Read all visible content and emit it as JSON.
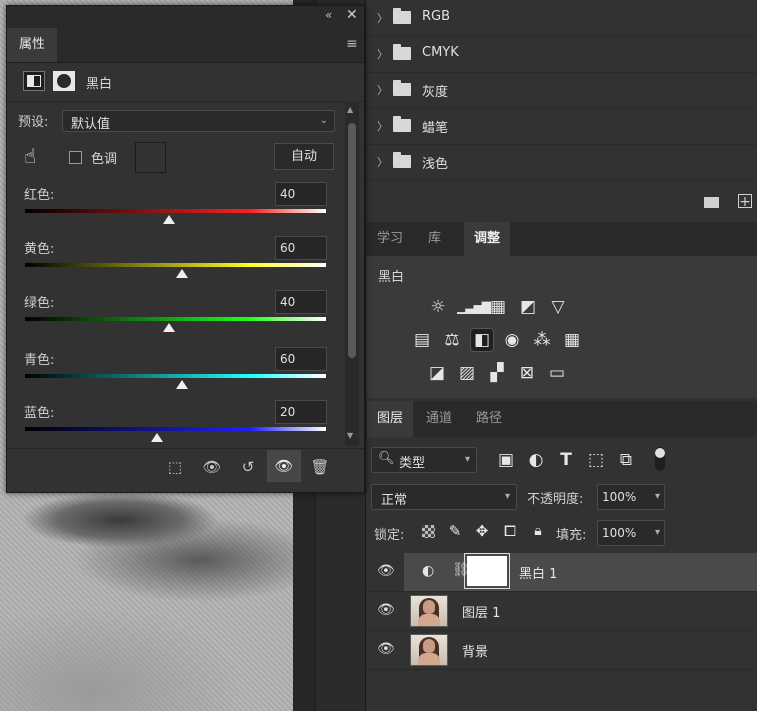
{
  "properties_panel": {
    "tab_label": "属性",
    "menu_icon": "hamburger-icon",
    "collapse_icon": "double-chevron-icon",
    "close_icon": "close-icon",
    "adjustment_name": "黑白",
    "preset_label": "预设:",
    "preset_value": "默认值",
    "tint_label": "色调",
    "auto_button": "自动",
    "sliders": [
      {
        "label": "红色:",
        "value": "40",
        "color": "#ff2020"
      },
      {
        "label": "黄色:",
        "value": "60",
        "color": "#ffff20"
      },
      {
        "label": "绿色:",
        "value": "40",
        "color": "#20ff20"
      },
      {
        "label": "青色:",
        "value": "60",
        "color": "#20ffff"
      },
      {
        "label": "蓝色:",
        "value": "20",
        "color": "#2020ff"
      }
    ]
  },
  "channels_panel": {
    "folders": [
      "RGB",
      "CMYK",
      "灰度",
      "蜡笔",
      "浅色"
    ]
  },
  "adjustments_panel": {
    "tabs": [
      "学习",
      "库",
      "调整"
    ],
    "active_tab": "调整",
    "current_label": "黑白"
  },
  "layers_panel": {
    "tabs": [
      "图层",
      "通道",
      "路径"
    ],
    "filter_kind": "类型",
    "blend_mode": "正常",
    "opacity_label": "不透明度:",
    "opacity_value": "100%",
    "lock_label": "锁定:",
    "fill_label": "填充:",
    "fill_value": "100%",
    "layers": [
      {
        "name": "黑白 1",
        "type": "adjustment",
        "selected": true
      },
      {
        "name": "图层 1",
        "type": "pixel",
        "selected": false
      },
      {
        "name": "背景",
        "type": "pixel",
        "selected": false
      }
    ]
  }
}
